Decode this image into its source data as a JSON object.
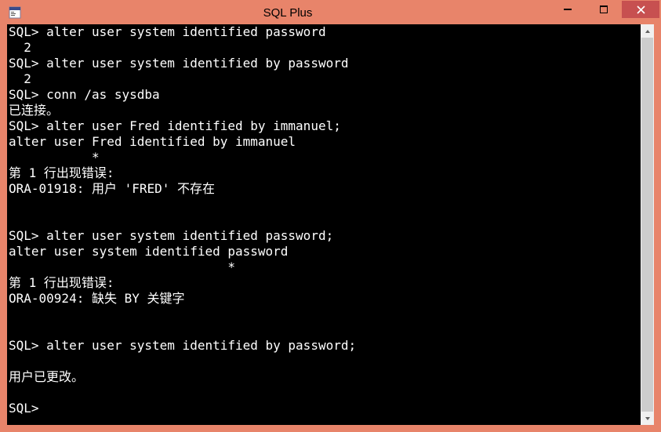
{
  "window": {
    "title": "SQL Plus"
  },
  "terminal": {
    "lines": [
      "SQL> alter user system identified password",
      "  2",
      "SQL> alter user system identified by password",
      "  2",
      "SQL> conn /as sysdba",
      "已连接。",
      "SQL> alter user Fred identified by immanuel;",
      "alter user Fred identified by immanuel",
      "           *",
      "第 1 行出现错误:",
      "ORA-01918: 用户 'FRED' 不存在",
      "",
      "",
      "SQL> alter user system identified password;",
      "alter user system identified password",
      "                             *",
      "第 1 行出现错误:",
      "ORA-00924: 缺失 BY 关键字",
      "",
      "",
      "SQL> alter user system identified by password;",
      "",
      "用户已更改。",
      "",
      "SQL>"
    ]
  }
}
